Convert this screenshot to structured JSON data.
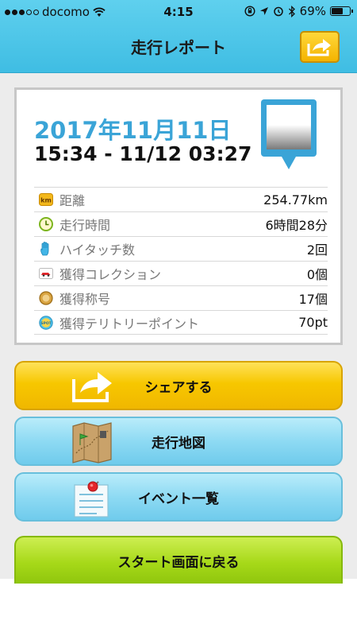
{
  "status_bar": {
    "carrier": "docomo",
    "time": "4:15",
    "battery": "69%",
    "battery_level": 0.69,
    "signal_filled": 3,
    "signal_total": 5
  },
  "nav": {
    "title": "走行レポート",
    "share_icon": "share-arrow-icon"
  },
  "report": {
    "date": "2017年11月11日",
    "time_range": "15:34 - 11/12 03:27",
    "stats": [
      {
        "icon": "km-icon",
        "label": "距離",
        "value": "254.77km"
      },
      {
        "icon": "clock-icon",
        "label": "走行時間",
        "value": "6時間28分"
      },
      {
        "icon": "hand-icon",
        "label": "ハイタッチ数",
        "value": "2回"
      },
      {
        "icon": "car-collection-icon",
        "label": "獲得コレクション",
        "value": "0個"
      },
      {
        "icon": "medal-icon",
        "label": "獲得称号",
        "value": "17個"
      },
      {
        "icon": "spot-icon",
        "label": "獲得テリトリーポイント",
        "value": "70pt"
      }
    ],
    "km_badge": "km",
    "spot_badge": "SPOT"
  },
  "buttons": {
    "share": "シェアする",
    "map": "走行地図",
    "events": "イベント一覧",
    "back_to_start": "スタート画面に戻る"
  },
  "colors": {
    "header": "#3fbde3",
    "date": "#3aa4d7",
    "share_button": "#f7c700",
    "blue_button": "#8edaf3",
    "green_button": "#a7d919"
  }
}
